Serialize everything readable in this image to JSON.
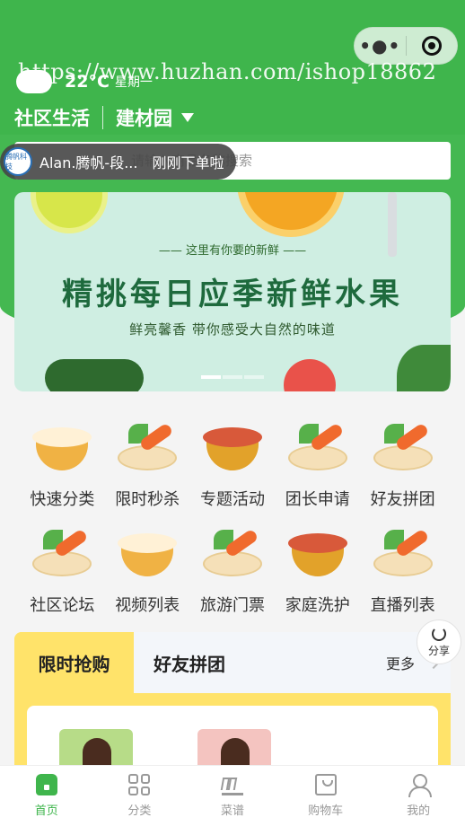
{
  "watermark": "https://www.huzhan.com/ishop18862",
  "weather": {
    "temperature": "22°C",
    "weekday": "星期一"
  },
  "location": {
    "community": "社区生活",
    "store": "建材园"
  },
  "search": {
    "placeholder": "请输入商品名称搜索"
  },
  "toast": {
    "user": "Alan.腾帆-段...",
    "message": "刚刚下单啦",
    "avatar_text": "腾帆科技"
  },
  "banner": {
    "subline": "—— 这里有你要的新鲜 ——",
    "headline": "精挑每日应季新鲜水果",
    "tagline": "鲜亮馨香 带你感受大自然的味道",
    "slides": 3,
    "active_slide": 1
  },
  "categories": [
    {
      "label": "快速分类",
      "icon": "buns-icon"
    },
    {
      "label": "限时秒杀",
      "icon": "vegetable-icon"
    },
    {
      "label": "专题活动",
      "icon": "soup-icon"
    },
    {
      "label": "团长申请",
      "icon": "vegetable-icon"
    },
    {
      "label": "好友拼团",
      "icon": "vegetable-icon"
    },
    {
      "label": "社区论坛",
      "icon": "vegetable-icon"
    },
    {
      "label": "视频列表",
      "icon": "buns-icon"
    },
    {
      "label": "旅游门票",
      "icon": "vegetable-icon"
    },
    {
      "label": "家庭洗护",
      "icon": "soup-icon"
    },
    {
      "label": "直播列表",
      "icon": "vegetable-icon"
    }
  ],
  "promo_tabs": {
    "active": "限时抢购",
    "inactive": "好友拼团",
    "more": "更多"
  },
  "share": {
    "label": "分享"
  },
  "tabbar": [
    {
      "label": "首页",
      "icon": "home-icon",
      "active": true
    },
    {
      "label": "分类",
      "icon": "category-grid-icon",
      "active": false
    },
    {
      "label": "菜谱",
      "icon": "crown-icon",
      "active": false
    },
    {
      "label": "购物车",
      "icon": "cart-icon",
      "active": false
    },
    {
      "label": "我的",
      "icon": "user-icon",
      "active": false
    }
  ],
  "colors": {
    "brand": "#3fb54c",
    "promo": "#ffe36a"
  }
}
